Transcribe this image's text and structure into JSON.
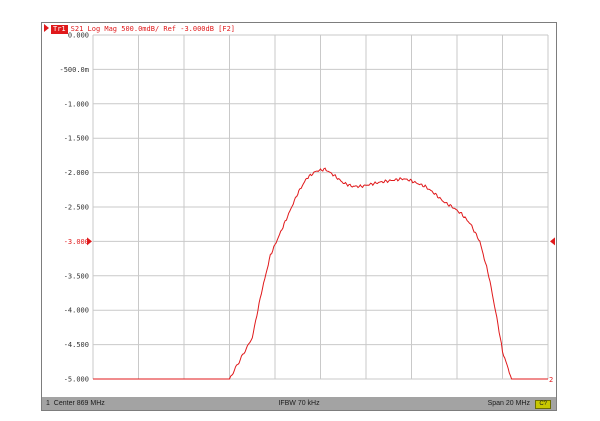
{
  "header": {
    "channel_badge": "Tr1",
    "trace_info": "S21 Log Mag 500.0mdB/ Ref -3.000dB [F2]"
  },
  "status": {
    "channel_num": "1",
    "center": "Center 869 MHz",
    "ifbw": "IFBW 70 kHz",
    "span": "Span 20 MHz",
    "indicator": "C?",
    "end_marker": "2"
  },
  "colors": {
    "trace": "#e0191b",
    "grid": "#c9c9c9",
    "status_bg": "#a3a3a3"
  },
  "chart_data": {
    "type": "line",
    "title": "S21 Log Mag 500.0mdB/ Ref -3.000dB [F2]",
    "xlabel": "",
    "ylabel": "",
    "xlim": [
      859,
      879
    ],
    "ylim": [
      -5.0,
      0.0
    ],
    "x_unit": "MHz",
    "y_unit": "dB",
    "reference_level": -3.0,
    "grid": true,
    "y_tick_labels": [
      "0.000",
      "-500.0m",
      "-1.000",
      "-1.500",
      "-2.000",
      "-2.500",
      "-3.000",
      "-3.500",
      "-4.000",
      "-4.500",
      "-5.000"
    ],
    "series": [
      {
        "name": "S21",
        "x": [
          859.0,
          862.0,
          865.0,
          866.0,
          866.4,
          866.8,
          867.2,
          867.6,
          868.0,
          868.4,
          868.8,
          869.2,
          869.6,
          870.0,
          870.4,
          870.8,
          871.2,
          871.6,
          872.0,
          872.4,
          872.6,
          872.8,
          873.0,
          873.2,
          873.6,
          874.0,
          874.4,
          874.8,
          875.2,
          875.6,
          876.0,
          876.4,
          876.8,
          877.0,
          877.4,
          879.0
        ],
        "y": [
          -5.0,
          -5.0,
          -5.0,
          -4.4,
          -3.75,
          -3.2,
          -2.9,
          -2.6,
          -2.3,
          -2.08,
          -1.98,
          -1.95,
          -2.04,
          -2.15,
          -2.2,
          -2.2,
          -2.17,
          -2.14,
          -2.12,
          -2.1,
          -2.09,
          -2.1,
          -2.12,
          -2.15,
          -2.2,
          -2.3,
          -2.42,
          -2.5,
          -2.6,
          -2.75,
          -3.0,
          -3.5,
          -4.2,
          -4.6,
          -5.0,
          -5.0
        ]
      }
    ]
  }
}
